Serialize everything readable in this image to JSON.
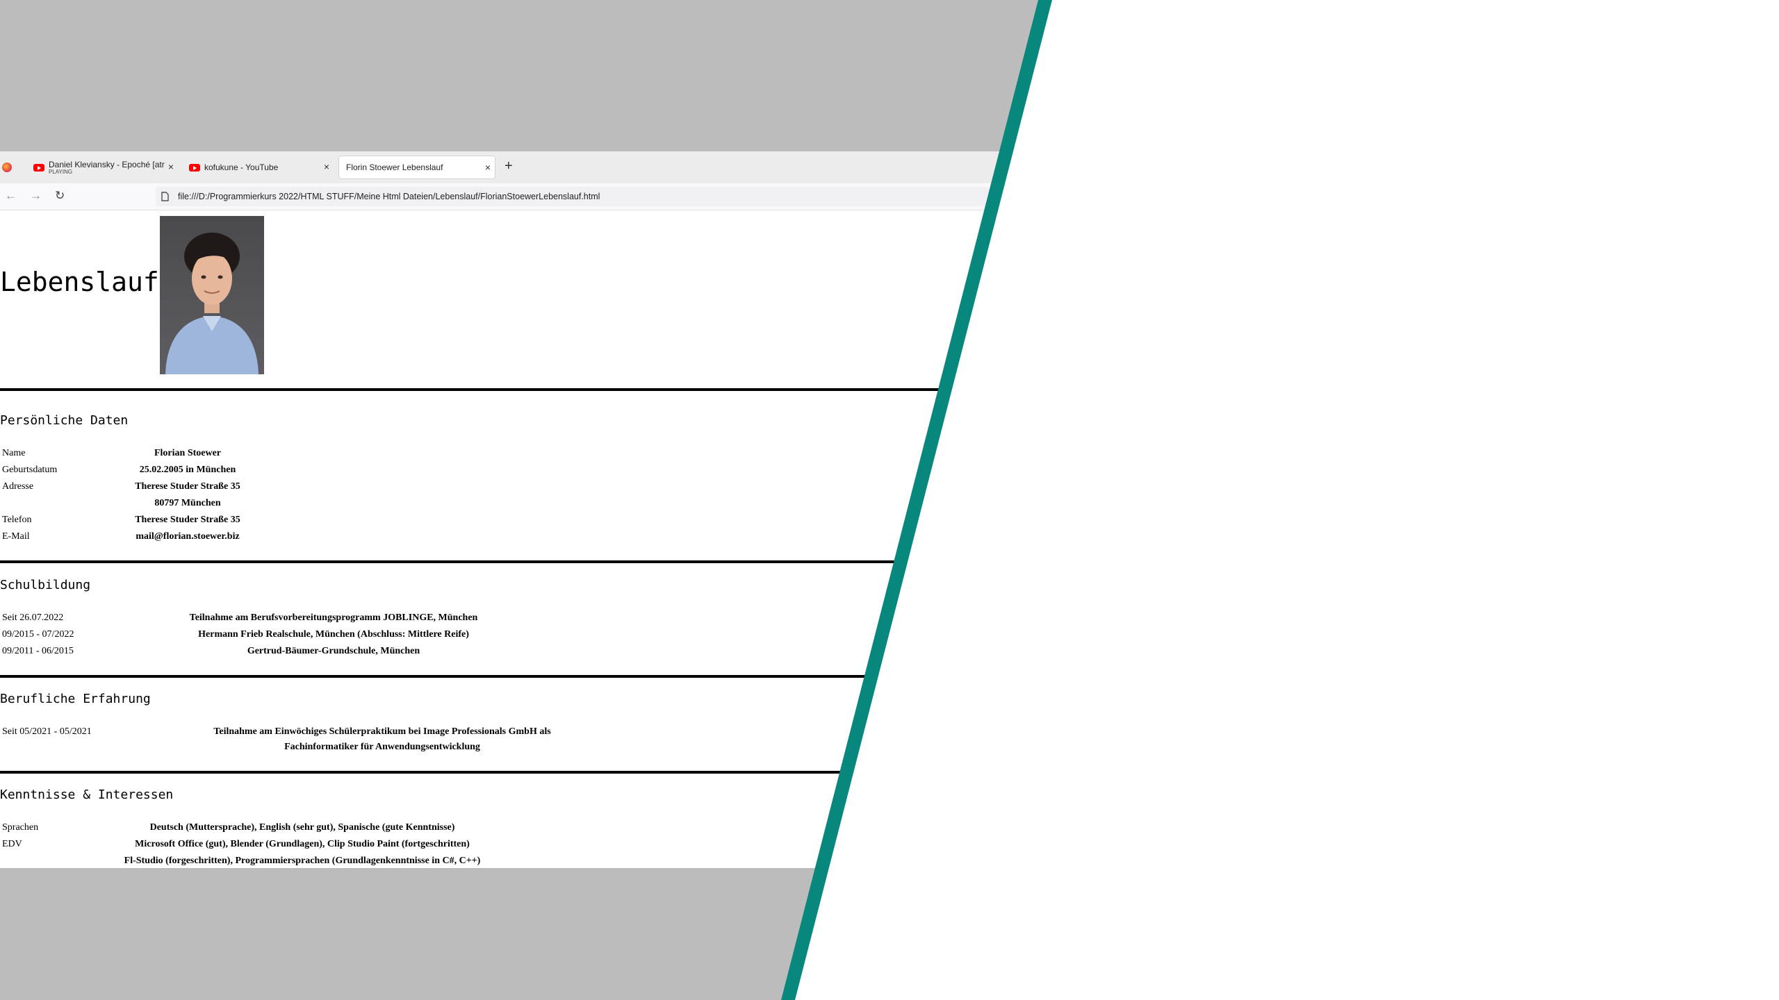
{
  "browser": {
    "tabs": [
      {
        "title": "Daniel Kleviansky - Epoché [atr",
        "sub": "PLAYING",
        "icon": "youtube-icon"
      },
      {
        "title": "kofukune - YouTube",
        "icon": "youtube-icon"
      },
      {
        "title": "Florin Stoewer Lebenslauf",
        "active": true
      }
    ],
    "new_tab": "+",
    "close": "×",
    "url": "file:///D:/Programmierkurs 2022/HTML STUFF/Meine Html Dateien/Lebenslauf/FlorianStoewerLebenslauf.html"
  },
  "page": {
    "title": "Lebenslauf",
    "personal": {
      "heading": "Persönliche Daten",
      "rows": [
        {
          "label": "Name",
          "value": "Florian Stoewer"
        },
        {
          "label": "Geburtsdatum",
          "value": "25.02.2005 in München"
        },
        {
          "label": "Adresse",
          "value": "Therese Studer Straße 35"
        },
        {
          "label": "",
          "value": "80797 München"
        },
        {
          "label": "Telefon",
          "value": "Therese Studer Straße 35"
        },
        {
          "label": "E-Mail",
          "value": "mail@florian.stoewer.biz"
        }
      ]
    },
    "school": {
      "heading": "Schulbildung",
      "rows": [
        {
          "label": "Seit 26.07.2022",
          "value": "Teilnahme am Berufsvorbereitungsprogramm JOBLINGE, München"
        },
        {
          "label": "09/2015 - 07/2022",
          "value": "Hermann Frieb Realschule, München (Abschluss: Mittlere Reife)"
        },
        {
          "label": "09/2011 - 06/2015",
          "value": "Gertrud-Bäumer-Grundschule, München"
        }
      ]
    },
    "work": {
      "heading": "Berufliche Erfahrung",
      "rows": [
        {
          "label": "Seit 05/2021 - 05/2021",
          "value1": "Teilnahme am Einwöchiges Schülerpraktikum bei Image Professionals GmbH als",
          "value2": "Fachinformatiker für Anwendungsentwicklung"
        }
      ]
    },
    "skills": {
      "heading": "Kenntnisse & Interessen",
      "rows": [
        {
          "label": "Sprachen",
          "value": "Deutsch (Muttersprache), English (sehr gut), Spanische (gute Kenntnisse)"
        },
        {
          "label": "EDV",
          "value": "Microsoft Office (gut), Blender (Grundlagen), Clip Studio Paint (fortgeschritten)"
        },
        {
          "label": "",
          "value": "Fl-Studio (forgeschritten), Programmiersprachen (Grundlagenkenntnisse in C#, C++)"
        }
      ]
    }
  },
  "colors": {
    "background": "#bcbcbc",
    "accent_stripe": "#08877c",
    "page": "#ffffff"
  }
}
